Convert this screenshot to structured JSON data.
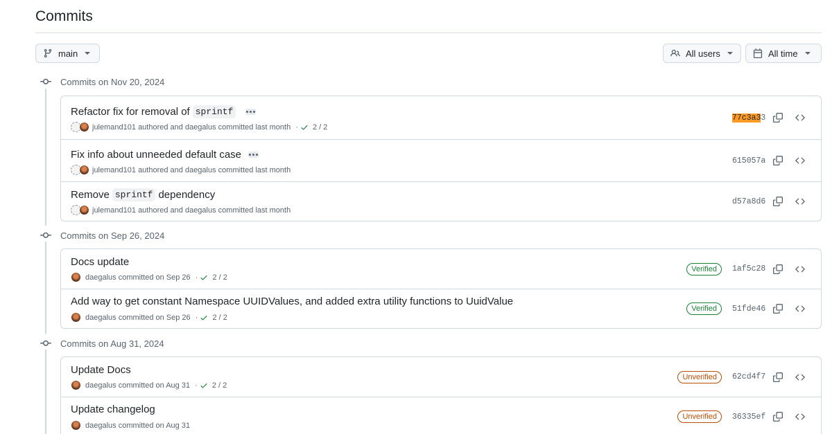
{
  "page": {
    "title": "Commits"
  },
  "toolbar": {
    "branch": "main",
    "users": "All users",
    "time": "All time"
  },
  "groups": [
    {
      "label": "Commits on Nov 20, 2024",
      "commits": [
        {
          "title_prefix": "Refactor fix for removal of",
          "code": "sprintf",
          "title_suffix": "",
          "author": "julemand101",
          "meta": "authored and daegalus committed last month",
          "checks": "2 / 2",
          "badge": "",
          "sha_hl": "77c3a3",
          "sha_rest": "3"
        },
        {
          "title_prefix": "Fix info about unneeded default case",
          "code": "",
          "title_suffix": "",
          "author": "julemand101",
          "meta": "authored and daegalus committed last month",
          "checks": "",
          "badge": "",
          "sha": "615057a"
        },
        {
          "title_prefix": "Remove",
          "code": "sprintf",
          "title_suffix": "dependency",
          "author": "julemand101",
          "meta": "authored and daegalus committed last month",
          "checks": "",
          "badge": "",
          "sha": "d57a8d6"
        }
      ]
    },
    {
      "label": "Commits on Sep 26, 2024",
      "commits": [
        {
          "title": "Docs update",
          "author": "daegalus",
          "meta": "committed on Sep 26",
          "checks": "2 / 2",
          "badge": "Verified",
          "sha": "1af5c28"
        },
        {
          "title": "Add way to get constant Namespace UUIDValues, and added extra utility functions to UuidValue",
          "author": "daegalus",
          "meta": "committed on Sep 26",
          "checks": "2 / 2",
          "badge": "Verified",
          "sha": "51fde46"
        }
      ]
    },
    {
      "label": "Commits on Aug 31, 2024",
      "commits": [
        {
          "title": "Update Docs",
          "author": "daegalus",
          "meta": "committed on Aug 31",
          "checks": "2 / 2",
          "badge": "Unverified",
          "sha": "62cd4f7"
        },
        {
          "title": "Update changelog",
          "author": "daegalus",
          "meta": "committed on Aug 31",
          "checks": "",
          "badge": "Unverified",
          "sha": "36335ef"
        }
      ]
    }
  ],
  "colors": {
    "accent_highlight": "#ff9b24",
    "verified": "#1a7f37",
    "unverified": "#bc4c00",
    "border": "#d1d9e0"
  },
  "icons": [
    "git-branch-icon",
    "people-icon",
    "calendar-icon",
    "git-commit-icon",
    "check-icon",
    "copy-icon",
    "code-icon",
    "ellipsis-icon"
  ]
}
